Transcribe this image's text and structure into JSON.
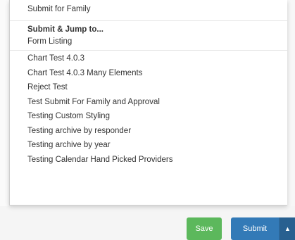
{
  "menu": {
    "top_item": "Submit for Family",
    "section_header": "Submit & Jump to...",
    "section_sub_item": "Form Listing",
    "items": [
      "Chart Test 4.0.3",
      "Chart Test 4.0.3 Many Elements",
      "Reject Test",
      "Test Submit For Family and Approval",
      "Testing Custom Styling",
      "Testing archive by responder",
      "Testing archive by year",
      "Testing Calendar Hand Picked Providers"
    ]
  },
  "actions": {
    "save_label": "Save",
    "submit_label": "Submit",
    "caret_icon": "▲"
  },
  "colors": {
    "save": "#5cb85c",
    "submit": "#337ab7",
    "submit_caret": "#286090"
  }
}
